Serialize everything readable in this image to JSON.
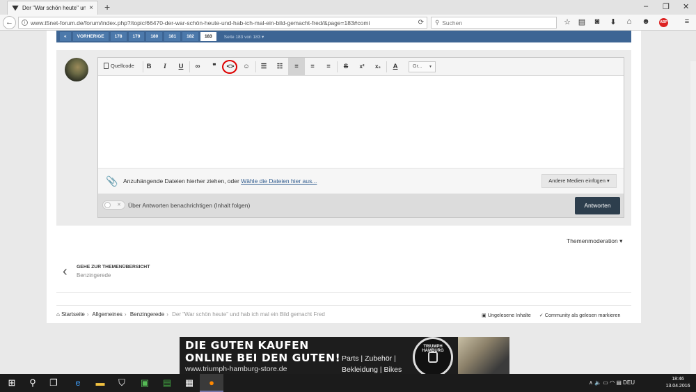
{
  "browser": {
    "tab_title": "Der \"War schön heute\" un...",
    "tab_close": "×",
    "new_tab": "+",
    "url": "www.t5net-forum.de/forum/index.php?/topic/66470-der-war-schön-heute-und-hab-ich-mal-ein-bild-gemacht-fred/&page=183#comi",
    "search_placeholder": "Suchen",
    "abp_label": "ABP",
    "window_buttons": [
      "–",
      "❐",
      "✕"
    ],
    "toolbar_icons": [
      "star-icon",
      "reading-list-icon",
      "pocket-icon",
      "download-icon",
      "home-icon",
      "emoji-icon",
      "adblock-icon",
      "menu-icon"
    ]
  },
  "pagination": {
    "first": "«",
    "prev": "VORHERIGE",
    "pages": [
      "178",
      "179",
      "180",
      "181",
      "182",
      "183"
    ],
    "current": "183",
    "summary": "Seite 183 von 183 ▾"
  },
  "editor": {
    "source_label": "Quellcode",
    "font_select": "Gr...",
    "attach_text": "Anzuhängende Dateien hierher ziehen, oder",
    "attach_link": "Wähle die Dateien hier aus...",
    "media_button": "Andere Medien einfügen ▾",
    "toggle_off": "✕",
    "notify_label": "Über Antworten benachrichtigen (Inhalt folgen)",
    "submit": "Antworten"
  },
  "moderation": "Themenmoderation ▾",
  "back_nav": {
    "title": "GEHE ZUR THEMENÜBERSICHT",
    "subtitle": "Benzingerede"
  },
  "breadcrumb": {
    "items": [
      "Startseite",
      "Allgemeines",
      "Benzingerede"
    ],
    "current": "Der \"War schön heute\" und hab ich mal ein Bild gemacht Fred"
  },
  "footer_actions": {
    "unread": "Ungelesene Inhalte",
    "mark_read": "Community als gelesen markieren"
  },
  "banner": {
    "line1": "DIE GUTEN KAUFEN",
    "line2": "ONLINE BEI DEN GUTEN!",
    "url": "www.triumph-hamburg-store.de",
    "products1": "Parts | Zubehör |",
    "products2": "Bekleidung | Bikes",
    "brand": "TRIUMPH HAMBURG"
  },
  "taskbar": {
    "lang": "DEU",
    "time": "18:46",
    "date": "13.04.2016"
  }
}
